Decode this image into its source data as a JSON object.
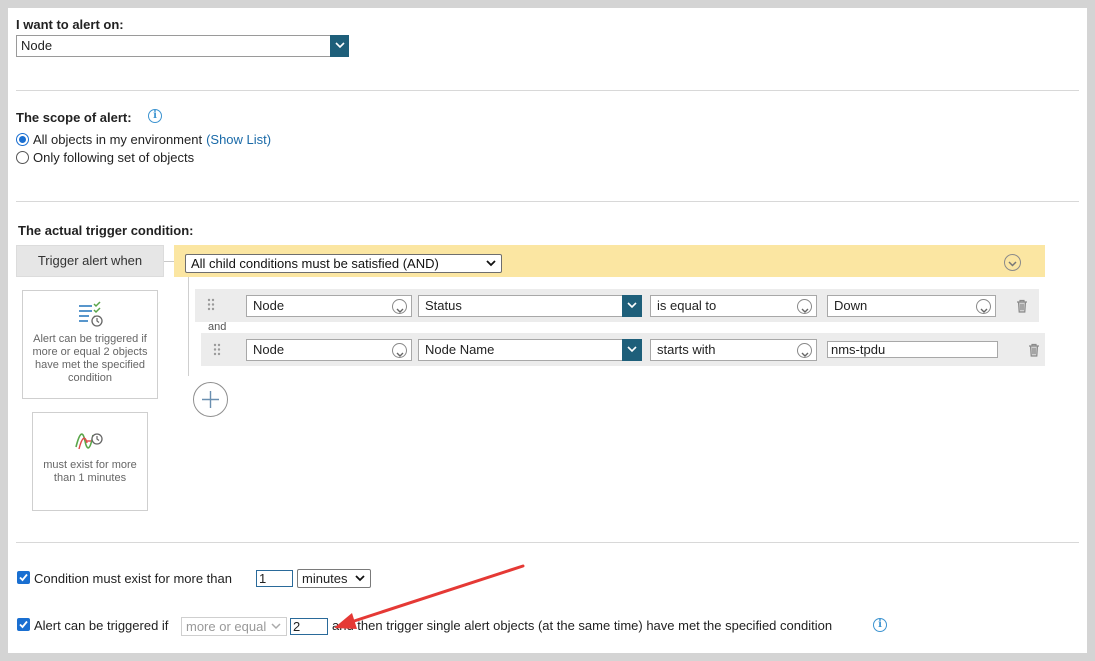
{
  "alert_on": {
    "label": "I want to alert on:",
    "value": "Node"
  },
  "scope": {
    "label": "The scope of alert:",
    "options": [
      {
        "label": "All objects in my environment",
        "link": "(Show List)",
        "selected": true
      },
      {
        "label": "Only following set of objects",
        "selected": false
      }
    ]
  },
  "trigger": {
    "label": "The actual trigger condition:",
    "when_label": "Trigger alert when",
    "condition_mode": "All child conditions must be satisfied (AND)",
    "connector": "and",
    "conditions": [
      {
        "object": "Node",
        "field": "Status",
        "operator": "is equal to",
        "value": "Down"
      },
      {
        "object": "Node",
        "field": "Node Name",
        "operator": "starts with",
        "value": "nms-tpdu"
      }
    ],
    "side_cards": [
      {
        "text": "Alert can be triggered if more or equal 2 objects have met the specified condition",
        "icon": "list-clock-icon"
      },
      {
        "text": "must exist for more than 1 minutes",
        "icon": "wave-clock-icon"
      }
    ]
  },
  "options": {
    "exist": {
      "checked": true,
      "label": "Condition must exist for more than",
      "value": "1",
      "unit": "minutes"
    },
    "triggered": {
      "checked": true,
      "label": "Alert can be triggered if",
      "comparison": "more or equal",
      "value": "2",
      "suffix": "and then trigger single alert objects (at the same time) have met the specified condition"
    }
  },
  "colors": {
    "accent": "#1e5f7a",
    "link": "#1a6aa8",
    "highlight": "#fbe6a2",
    "arrow": "#e53935"
  }
}
